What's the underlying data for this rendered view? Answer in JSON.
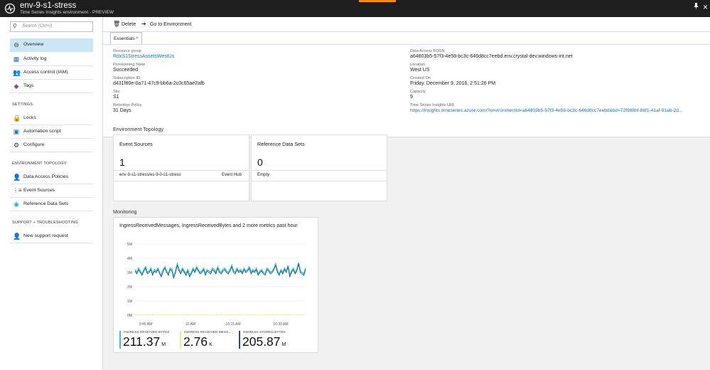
{
  "window": {
    "title": "env-9-s1-stress",
    "subtitle": "Time Series Insights environment - PREVIEW",
    "pin_icon": "pin-icon",
    "close_label": "×"
  },
  "search": {
    "placeholder": "Search (Ctrl+/)"
  },
  "sidebar": {
    "items": [
      {
        "label": "Overview",
        "icon": "overview-icon",
        "active": true
      },
      {
        "label": "Activity log",
        "icon": "activity-log-icon"
      },
      {
        "label": "Access control (IAM)",
        "icon": "access-control-icon"
      },
      {
        "label": "Tags",
        "icon": "tag-icon"
      }
    ],
    "settings_header": "SETTINGS",
    "settings_items": [
      {
        "label": "Locks",
        "icon": "lock-icon"
      },
      {
        "label": "Automation script",
        "icon": "automation-script-icon"
      },
      {
        "label": "Configure",
        "icon": "gear-icon"
      }
    ],
    "topology_header": "ENVIRONMENT TOPOLOGY",
    "topology_items": [
      {
        "label": "Data Access Policies",
        "icon": "data-access-policies-icon"
      },
      {
        "label": "Event Sources",
        "icon": "event-sources-icon"
      },
      {
        "label": "Reference Data Sets",
        "icon": "reference-data-sets-icon"
      }
    ],
    "support_header": "SUPPORT + TROUBLESHOOTING",
    "support_items": [
      {
        "label": "New support request",
        "icon": "support-request-icon"
      }
    ]
  },
  "toolbar": {
    "delete_label": "Delete",
    "goto_label": "Go to Environment"
  },
  "essentials": {
    "tab_label": "Essentials",
    "left": [
      {
        "label": "Resource group",
        "value": "RdxS1StressAssetsWestUs",
        "link": true
      },
      {
        "label": "Provisioning State",
        "value": "Succeeded"
      },
      {
        "label": "Subscription ID",
        "value": "d431f80e-0a71-47c9-bb6a-2c0c65ae2afb"
      },
      {
        "label": "Sku",
        "value": "S1"
      },
      {
        "label": "Retention Policy",
        "value": "31 Days"
      }
    ],
    "right": [
      {
        "label": "Data Access FQDN",
        "value": "a64803b5-57f3-4e58-bc3c-646d8cc7eebd.env.crystal-dev.windows-int.net"
      },
      {
        "label": "Location",
        "value": "West US"
      },
      {
        "label": "Created On",
        "value": "Friday, December 9, 2016, 2:51:26 PM"
      },
      {
        "label": "Capacity",
        "value": "9"
      },
      {
        "label": "Time Series Insights URL",
        "value": "https://insights.timeseries.azure.com/?environmentId=a64803b5-57f3-4e58-bc3c-646d8cc7eebd&tid=72f988bf-86f1-41af-91ab-2d...",
        "link": true
      }
    ]
  },
  "topology": {
    "title": "Environment Topology",
    "event_sources": {
      "title": "Event Sources",
      "count": "1",
      "row_name": "env-9-s1-stress/es-9-0-s1-stress",
      "row_type": "Event Hub"
    },
    "reference_data": {
      "title": "Reference Data Sets",
      "count": "0",
      "row_name": "Empty"
    }
  },
  "monitoring": {
    "title": "Monitoring",
    "card_title": "IngressReceivedMessages, IngressReceivedBytes and 2 more metrics past hour",
    "tiles": [
      {
        "label": "INGRESS RECEIVED BYTES",
        "value": "211.37",
        "unit": "M",
        "color": "#3bc5cf"
      },
      {
        "label": "INGRESS RECEIVED MESS...",
        "value": "2.76",
        "unit": "K",
        "color": "#f7ea8c"
      },
      {
        "label": "INGRESS STORED BYTES",
        "value": "205.87",
        "unit": "M",
        "color": "#1f4f8f"
      }
    ]
  },
  "chart_data": {
    "type": "line",
    "y_tick_labels": [
      "5M",
      "4M",
      "3M",
      "2M",
      "1M",
      "0M"
    ],
    "ylim": [
      0,
      5
    ],
    "x_tick_labels": [
      "9:45 AM",
      "10 AM",
      "10:15 AM",
      "10:30 AM"
    ],
    "grid": true,
    "series": [
      {
        "color": "#3bc5cf",
        "values": [
          3.2,
          3.0,
          3.3,
          3.1,
          2.9,
          3.2,
          3.4,
          3.0,
          3.1,
          3.3,
          2.9,
          3.2,
          3.1,
          3.3,
          3.0,
          2.8,
          3.2,
          3.4,
          3.1,
          2.9,
          3.3,
          3.2,
          2.7,
          3.1,
          3.6,
          3.2,
          3.0,
          3.3,
          3.1,
          2.9,
          3.2,
          2.8,
          3.0,
          3.3,
          3.1,
          3.4,
          3.2,
          3.0,
          3.1,
          3.3,
          2.9,
          3.2,
          3.1,
          3.0,
          3.3,
          3.2,
          3.0,
          3.4,
          3.1,
          3.0,
          3.2,
          3.3,
          3.1,
          3.0,
          3.2,
          3.5,
          3.1,
          3.0,
          3.3,
          3.1,
          3.2,
          3.0,
          3.3,
          3.1,
          3.2,
          3.4,
          3.0,
          3.2,
          3.1,
          3.3,
          2.9,
          3.1,
          3.2,
          3.0,
          2.9,
          3.3,
          3.2,
          3.0,
          3.1,
          3.3,
          3.6,
          3.1,
          2.9,
          3.2,
          3.0,
          3.3,
          3.1,
          3.5,
          2.8,
          3.1,
          3.3,
          3.0,
          3.2,
          3.7,
          3.1,
          3.0,
          2.9,
          3.3
        ]
      },
      {
        "color": "#1f4f8f",
        "values": [
          3.1,
          2.9,
          3.2,
          3.0,
          2.8,
          3.1,
          3.3,
          2.9,
          3.0,
          3.2,
          2.8,
          3.1,
          3.0,
          3.2,
          2.9,
          2.7,
          3.1,
          3.3,
          3.0,
          2.8,
          3.2,
          3.1,
          2.6,
          3.0,
          3.5,
          3.1,
          2.9,
          3.2,
          3.0,
          2.8,
          3.1,
          2.7,
          2.9,
          3.2,
          3.0,
          3.3,
          3.1,
          2.9,
          3.0,
          3.2,
          2.8,
          3.1,
          3.0,
          2.9,
          3.2,
          3.1,
          2.9,
          3.3,
          3.0,
          2.9,
          3.1,
          3.2,
          3.0,
          2.9,
          3.1,
          3.4,
          3.0,
          2.9,
          3.2,
          3.0,
          3.1,
          2.9,
          3.2,
          3.0,
          3.1,
          3.3,
          2.9,
          3.1,
          3.0,
          3.2,
          2.8,
          3.0,
          3.1,
          2.9,
          2.8,
          3.2,
          3.1,
          2.9,
          3.0,
          3.2,
          3.5,
          3.0,
          2.8,
          3.1,
          2.9,
          3.2,
          3.0,
          3.4,
          2.7,
          3.0,
          3.2,
          2.9,
          3.1,
          3.6,
          3.0,
          2.9,
          2.8,
          3.2
        ]
      },
      {
        "color": "#f7ea8c",
        "values": [
          0.05,
          0.05,
          0.05,
          0.05,
          0.05,
          0.05,
          0.05,
          0.05,
          0.05,
          0.05,
          0.05,
          0.05
        ]
      }
    ]
  }
}
